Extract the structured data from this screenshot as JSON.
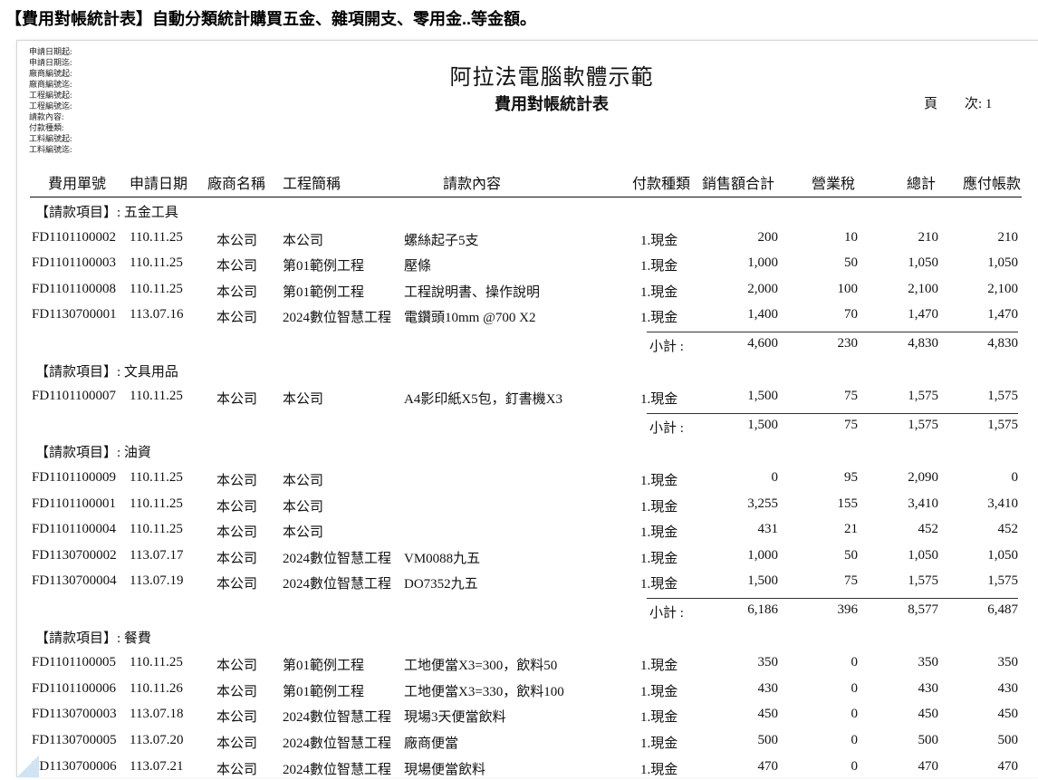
{
  "headline": "【費用對帳統計表】自動分類統計購買五金、雜項開支、零用金..等金額。",
  "filters": [
    "申請日期起:",
    "申請日期迄:",
    "廠商編號起:",
    "廠商編號迄:",
    "工程編號起:",
    "工程編號迄:",
    "請款內容:",
    "付款種類:",
    "工料編號起:",
    "工料編號迄:"
  ],
  "company": "阿拉法電腦軟體示範",
  "report_title": "費用對帳統計表",
  "page_label": "頁　　次:",
  "page_num": "1",
  "columns": [
    "費用單號",
    "申請日期",
    "廠商名稱",
    "工程簡稱",
    "請款內容",
    "付款種類",
    "銷售額合計",
    "營業稅",
    "總計",
    "應付帳款"
  ],
  "subtotal_label": "小計 :",
  "groups": [
    {
      "title": "【請款項目】: 五金工具",
      "rows": [
        [
          "FD1101100002",
          "110.11.25",
          "本公司",
          "本公司",
          "螺絲起子5支",
          "1.現金",
          "200",
          "10",
          "210",
          "210"
        ],
        [
          "FD1101100003",
          "110.11.25",
          "本公司",
          "第01範例工程",
          "壓條",
          "1.現金",
          "1,000",
          "50",
          "1,050",
          "1,050"
        ],
        [
          "FD1101100008",
          "110.11.25",
          "本公司",
          "第01範例工程",
          "工程說明書、操作說明",
          "1.現金",
          "2,000",
          "100",
          "2,100",
          "2,100"
        ],
        [
          "FD1130700001",
          "113.07.16",
          "本公司",
          "2024數位智慧工程",
          "電鑽頭10mm @700 X2",
          "1.現金",
          "1,400",
          "70",
          "1,470",
          "1,470"
        ]
      ],
      "subtotal": [
        "4,600",
        "230",
        "4,830",
        "4,830"
      ]
    },
    {
      "title": "【請款項目】: 文具用品",
      "rows": [
        [
          "FD1101100007",
          "110.11.25",
          "本公司",
          "本公司",
          "A4影印紙X5包，釘書機X3",
          "1.現金",
          "1,500",
          "75",
          "1,575",
          "1,575"
        ]
      ],
      "subtotal": [
        "1,500",
        "75",
        "1,575",
        "1,575"
      ]
    },
    {
      "title": "【請款項目】: 油資",
      "rows": [
        [
          "FD1101100009",
          "110.11.25",
          "本公司",
          "本公司",
          "",
          "1.現金",
          "0",
          "95",
          "2,090",
          "0"
        ],
        [
          "FD1101100001",
          "110.11.25",
          "本公司",
          "本公司",
          "",
          "1.現金",
          "3,255",
          "155",
          "3,410",
          "3,410"
        ],
        [
          "FD1101100004",
          "110.11.25",
          "本公司",
          "本公司",
          "",
          "1.現金",
          "431",
          "21",
          "452",
          "452"
        ],
        [
          "FD1130700002",
          "113.07.17",
          "本公司",
          "2024數位智慧工程",
          "VM0088九五",
          "1.現金",
          "1,000",
          "50",
          "1,050",
          "1,050"
        ],
        [
          "FD1130700004",
          "113.07.19",
          "本公司",
          "2024數位智慧工程",
          "DO7352九五",
          "1.現金",
          "1,500",
          "75",
          "1,575",
          "1,575"
        ]
      ],
      "subtotal": [
        "6,186",
        "396",
        "8,577",
        "6,487"
      ]
    },
    {
      "title": "【請款項目】: 餐費",
      "rows": [
        [
          "FD1101100005",
          "110.11.25",
          "本公司",
          "第01範例工程",
          "工地便當X3=300，飲料50",
          "1.現金",
          "350",
          "0",
          "350",
          "350"
        ],
        [
          "FD1101100006",
          "110.11.26",
          "本公司",
          "第01範例工程",
          "工地便當X3=330，飲料100",
          "1.現金",
          "430",
          "0",
          "430",
          "430"
        ],
        [
          "FD1130700003",
          "113.07.18",
          "本公司",
          "2024數位智慧工程",
          "現場3天便當飲料",
          "1.現金",
          "450",
          "0",
          "450",
          "450"
        ],
        [
          "FD1130700005",
          "113.07.20",
          "本公司",
          "2024數位智慧工程",
          "廠商便當",
          "1.現金",
          "500",
          "0",
          "500",
          "500"
        ],
        [
          "FD1130700006",
          "113.07.21",
          "本公司",
          "2024數位智慧工程",
          "現場便當飲料",
          "1.現金",
          "470",
          "0",
          "470",
          "470"
        ]
      ]
    }
  ]
}
